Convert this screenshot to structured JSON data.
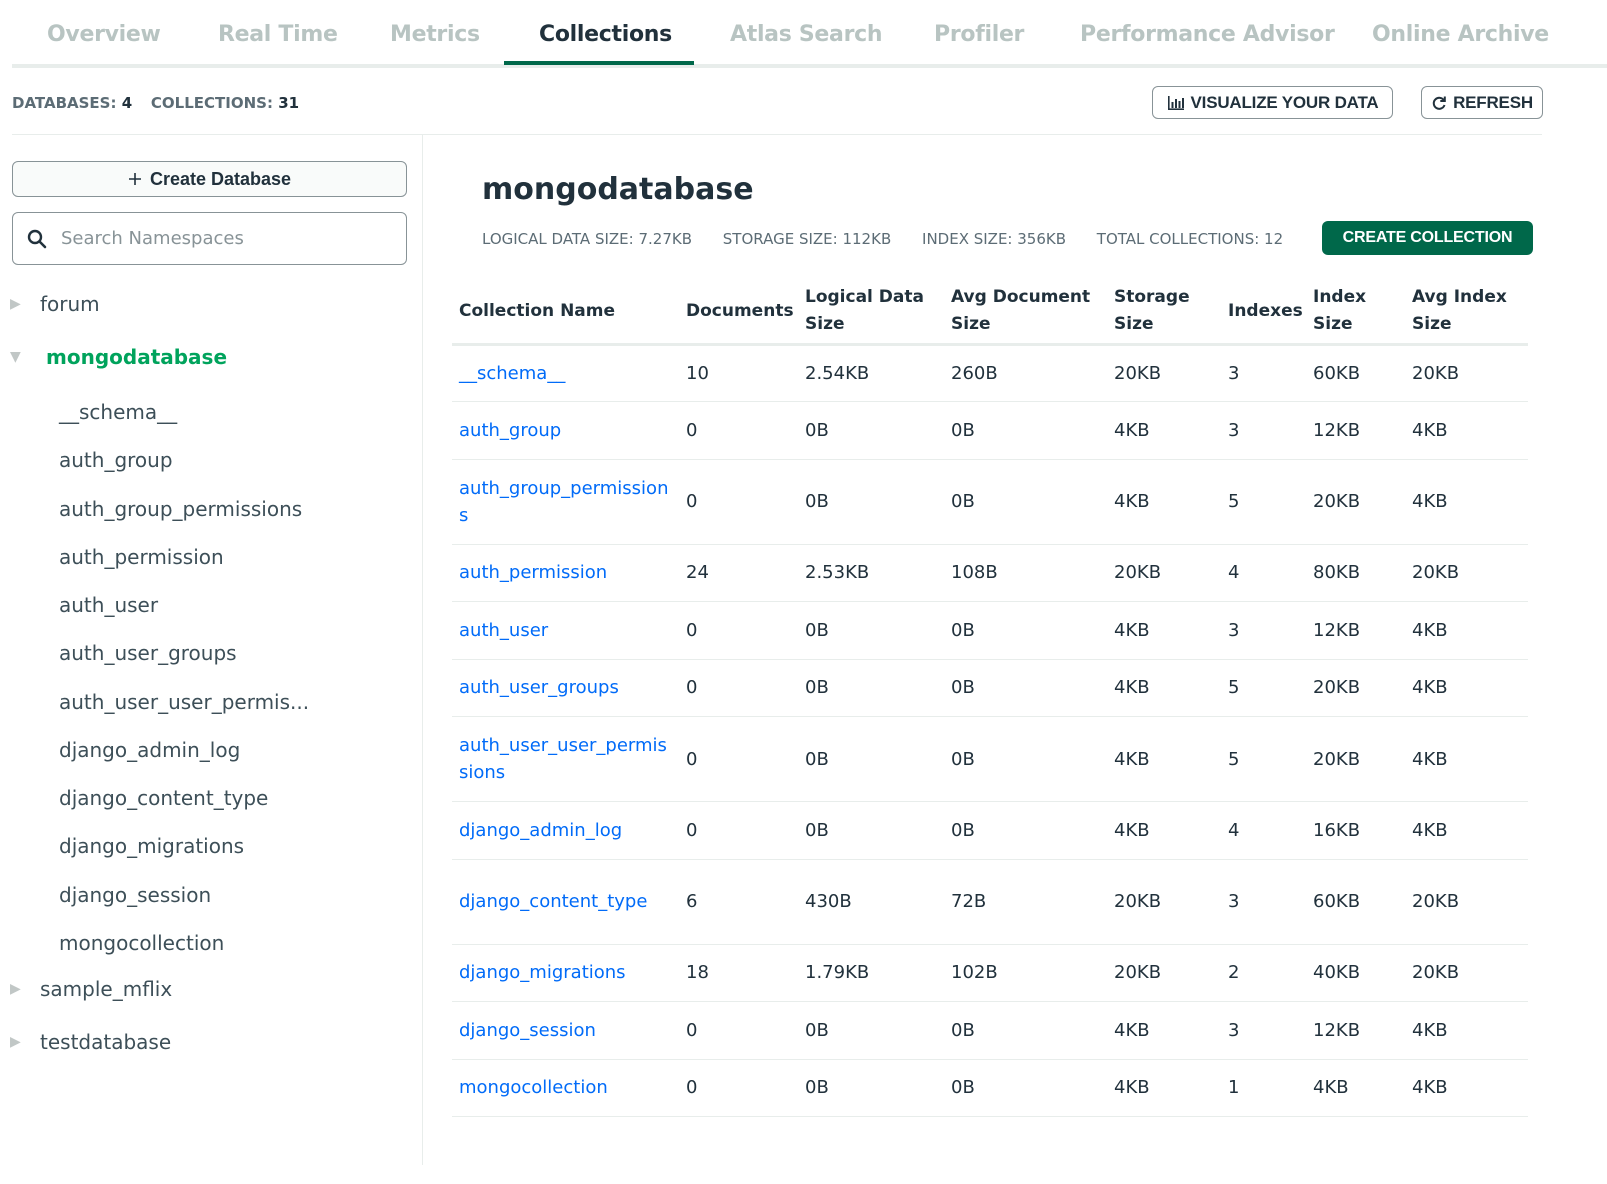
{
  "tabs": [
    {
      "label": "Overview",
      "active": false
    },
    {
      "label": "Real Time",
      "active": false
    },
    {
      "label": "Metrics",
      "active": false
    },
    {
      "label": "Collections",
      "active": true
    },
    {
      "label": "Atlas Search",
      "active": false
    },
    {
      "label": "Profiler",
      "active": false
    },
    {
      "label": "Performance Advisor",
      "active": false
    },
    {
      "label": "Online Archive",
      "active": false
    }
  ],
  "summary": {
    "databases_label": "DATABASES:",
    "databases_value": "4",
    "collections_label": "COLLECTIONS:",
    "collections_value": "31"
  },
  "toolbar": {
    "visualize_label": "VISUALIZE YOUR DATA",
    "visualize_icon": "bar-chart-icon",
    "refresh_label": "REFRESH",
    "refresh_icon": "refresh-icon"
  },
  "sidebar": {
    "create_db_label": "Create Database",
    "create_db_icon": "plus-icon",
    "search_placeholder": "Search Namespaces",
    "search_icon": "search-icon",
    "databases": [
      {
        "name": "forum",
        "expanded": false
      },
      {
        "name": "mongodatabase",
        "expanded": true,
        "collections": [
          "__schema__",
          "auth_group",
          "auth_group_permissions",
          "auth_permission",
          "auth_user",
          "auth_user_groups",
          "auth_user_user_permis...",
          "django_admin_log",
          "django_content_type",
          "django_migrations",
          "django_session",
          "mongocollection"
        ]
      },
      {
        "name": "sample_mflix",
        "expanded": false
      },
      {
        "name": "testdatabase",
        "expanded": false
      }
    ]
  },
  "main": {
    "db_name": "mongodatabase",
    "stats": {
      "logical": "LOGICAL DATA SIZE: 7.27KB",
      "storage": "STORAGE SIZE: 112KB",
      "index": "INDEX SIZE: 356KB",
      "total": "TOTAL COLLECTIONS: 12"
    },
    "create_collection_label": "CREATE COLLECTION",
    "columns": [
      "Collection Name",
      "Documents",
      "Logical Data Size",
      "Avg Document Size",
      "Storage Size",
      "Indexes",
      "Index Size",
      "Avg Index Size"
    ],
    "rows": [
      [
        "__schema__",
        "10",
        "2.54KB",
        "260B",
        "20KB",
        "3",
        "60KB",
        "20KB"
      ],
      [
        "auth_group",
        "0",
        "0B",
        "0B",
        "4KB",
        "3",
        "12KB",
        "4KB"
      ],
      [
        "auth_group_permissions",
        "0",
        "0B",
        "0B",
        "4KB",
        "5",
        "20KB",
        "4KB"
      ],
      [
        "auth_permission",
        "24",
        "2.53KB",
        "108B",
        "20KB",
        "4",
        "80KB",
        "20KB"
      ],
      [
        "auth_user",
        "0",
        "0B",
        "0B",
        "4KB",
        "3",
        "12KB",
        "4KB"
      ],
      [
        "auth_user_groups",
        "0",
        "0B",
        "0B",
        "4KB",
        "5",
        "20KB",
        "4KB"
      ],
      [
        "auth_user_user_permissions",
        "0",
        "0B",
        "0B",
        "4KB",
        "5",
        "20KB",
        "4KB"
      ],
      [
        "django_admin_log",
        "0",
        "0B",
        "0B",
        "4KB",
        "4",
        "16KB",
        "4KB"
      ],
      [
        "django_content_type",
        "6",
        "430B",
        "72B",
        "20KB",
        "3",
        "60KB",
        "20KB"
      ],
      [
        "django_migrations",
        "18",
        "1.79KB",
        "102B",
        "20KB",
        "2",
        "40KB",
        "20KB"
      ],
      [
        "django_session",
        "0",
        "0B",
        "0B",
        "4KB",
        "3",
        "12KB",
        "4KB"
      ],
      [
        "mongocollection",
        "0",
        "0B",
        "0B",
        "4KB",
        "1",
        "4KB",
        "4KB"
      ]
    ]
  },
  "colors": {
    "accent_green": "#00684a",
    "active_db_green": "#00a35c",
    "link_blue": "#016bf8",
    "text_dark": "#21313c",
    "tab_inactive": "#b8c4c2"
  }
}
